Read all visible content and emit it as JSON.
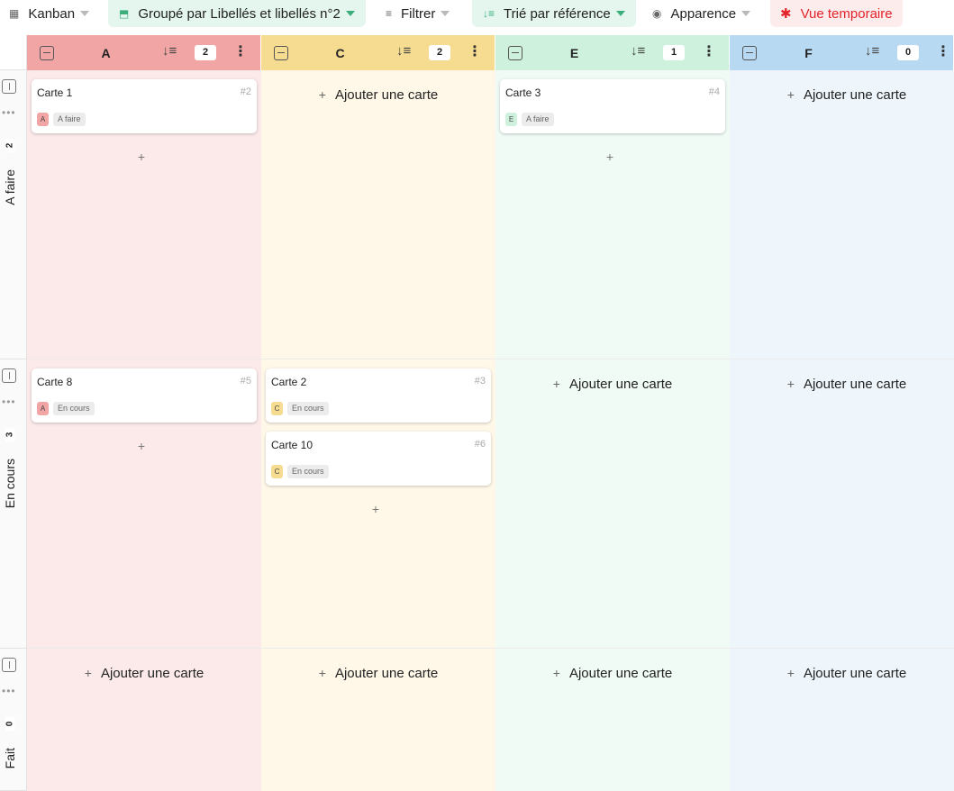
{
  "toolbar": {
    "kanban_label": "Kanban",
    "grouped_label": "Groupé par Libellés et libellés n°2",
    "filter_label": "Filtrer",
    "sort_label": "Trié par référence",
    "appearance_label": "Apparence",
    "temp_view_label": "Vue temporaire"
  },
  "columns": [
    {
      "title": "A",
      "count": "2",
      "header_color": "#f1a5a5",
      "body_color": "#fceaea"
    },
    {
      "title": "C",
      "count": "2",
      "header_color": "#f6dc91",
      "body_color": "#fff8e9"
    },
    {
      "title": "E",
      "count": "1",
      "header_color": "#cdf1dc",
      "body_color": "#f0fbf5"
    },
    {
      "title": "F",
      "count": "0",
      "header_color": "#b7d9f1",
      "body_color": "#eef6fb"
    }
  ],
  "rows": [
    {
      "name": "A faire",
      "count": "2"
    },
    {
      "name": "En cours",
      "count": "3"
    },
    {
      "name": "Fait",
      "count": "0"
    }
  ],
  "add_card_label": "Ajouter une carte",
  "cards": [
    {
      "title": "Carte 1",
      "ref": "#2",
      "letter": "A",
      "status": "A faire",
      "letter_color": "#f1a5a5"
    },
    {
      "title": "Carte 3",
      "ref": "#4",
      "letter": "E",
      "status": "A faire",
      "letter_color": "#cdf1dc"
    },
    {
      "title": "Carte 8",
      "ref": "#5",
      "letter": "A",
      "status": "En cours",
      "letter_color": "#f1a5a5"
    },
    {
      "title": "Carte 2",
      "ref": "#3",
      "letter": "C",
      "status": "En cours",
      "letter_color": "#f6dc91"
    },
    {
      "title": "Carte 10",
      "ref": "#6",
      "letter": "C",
      "status": "En cours",
      "letter_color": "#f6dc91"
    }
  ]
}
